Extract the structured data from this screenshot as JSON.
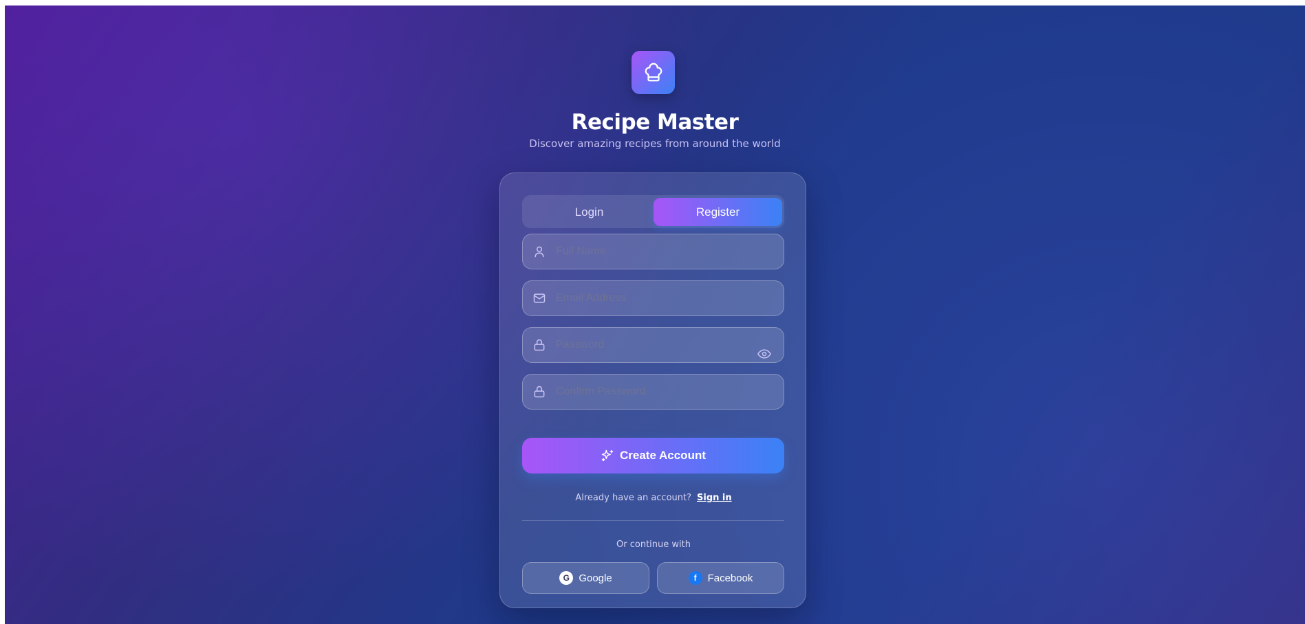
{
  "brand": {
    "title": "Recipe Master",
    "subtitle": "Discover amazing recipes from around the world",
    "logo_icon": "chef-hat-icon"
  },
  "tabs": [
    {
      "label": "Login",
      "active": false
    },
    {
      "label": "Register",
      "active": true
    }
  ],
  "form": {
    "full_name": {
      "placeholder": "Full Name",
      "value": "",
      "icon": "user-icon"
    },
    "email": {
      "placeholder": "Email Address",
      "value": "",
      "icon": "mail-icon"
    },
    "password": {
      "placeholder": "Password",
      "value": "",
      "icon": "lock-icon",
      "toggle_icon": "eye-icon"
    },
    "confirm_password": {
      "placeholder": "Confirm Password",
      "value": "",
      "icon": "lock-icon"
    },
    "submit_label": "Create Account",
    "submit_icon": "sparkles-icon"
  },
  "switch": {
    "prompt": "Already have an account?",
    "link": "Sign in"
  },
  "social": {
    "heading": "Or continue with",
    "google": {
      "label": "Google",
      "badge": "G"
    },
    "facebook": {
      "label": "Facebook",
      "badge": "f"
    }
  },
  "colors": {
    "accent_start": "#a855f7",
    "accent_end": "#3b82f6",
    "background_start": "#4c1d95",
    "background_end": "#1e3a8a",
    "facebook": "#1877f2"
  }
}
